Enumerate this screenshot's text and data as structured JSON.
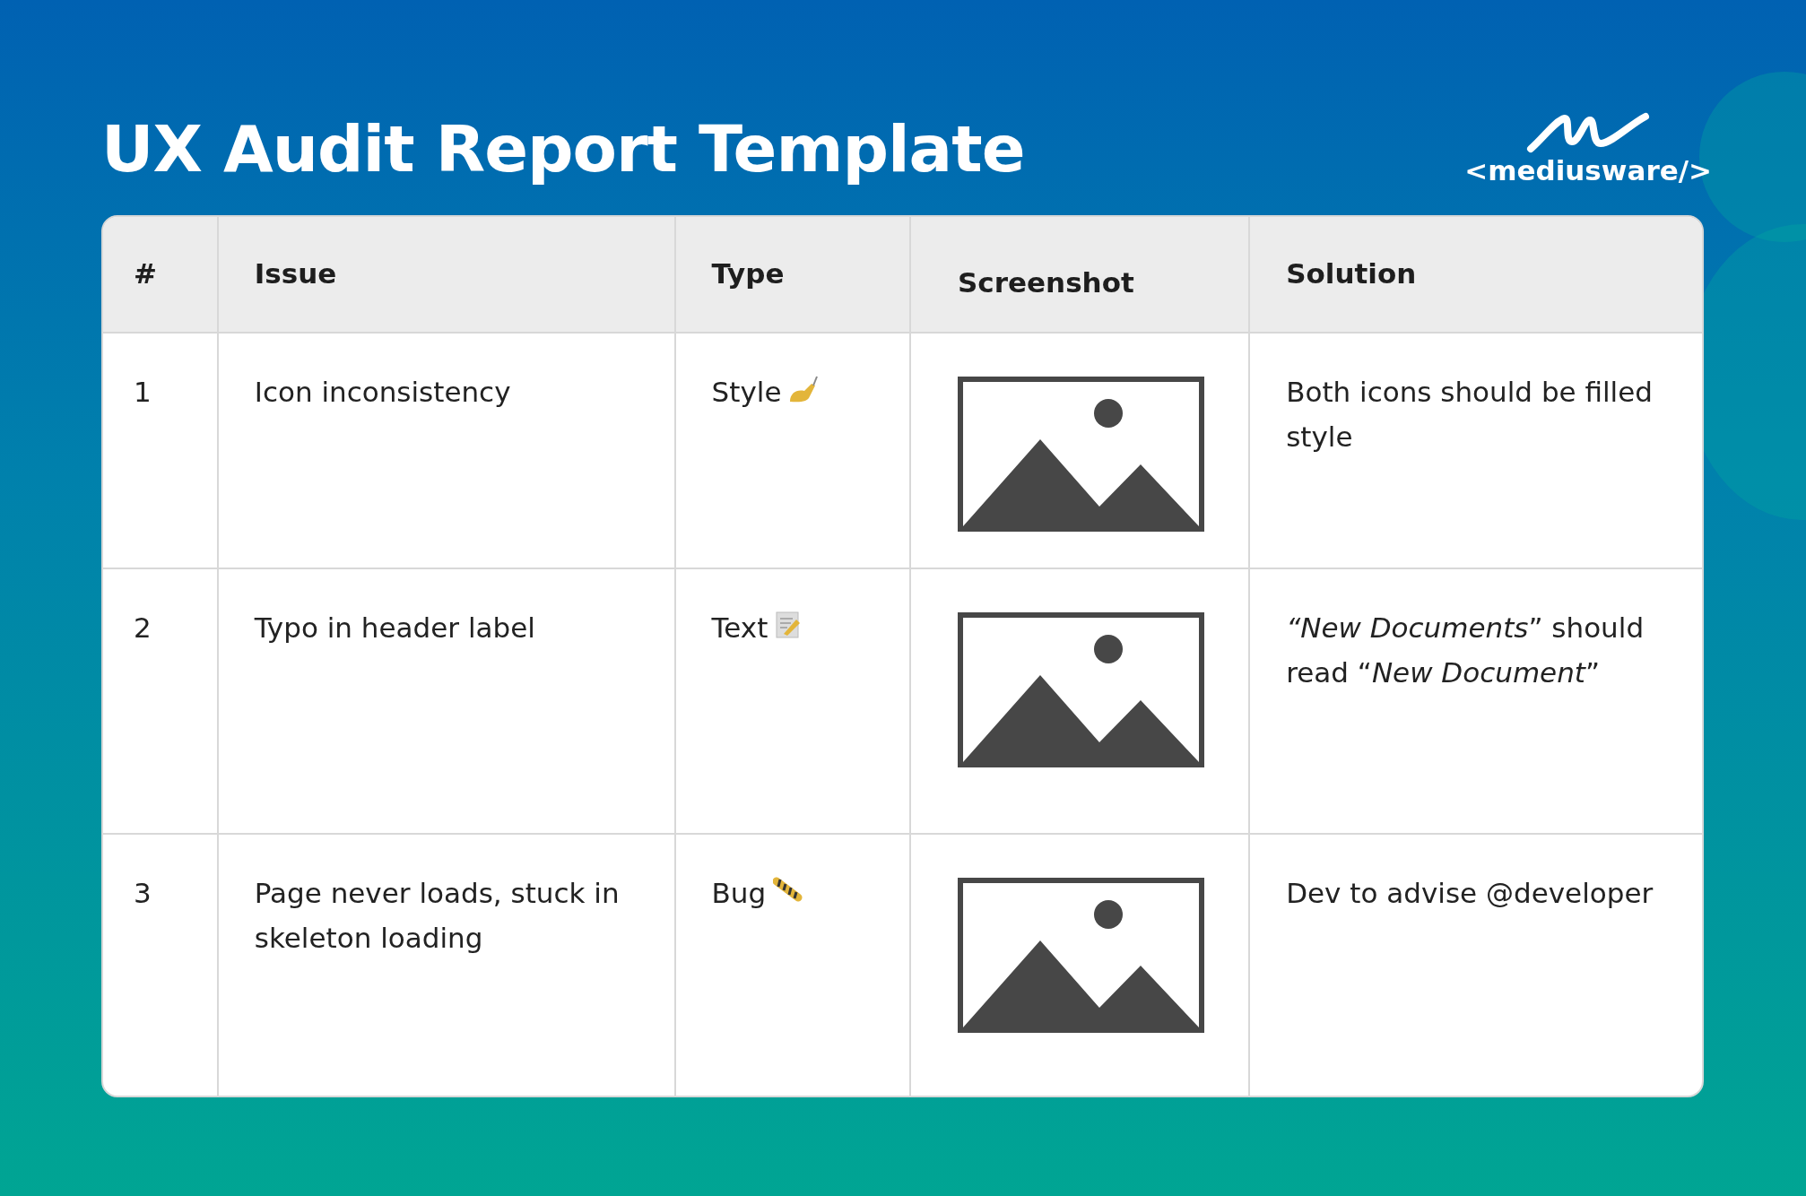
{
  "title": "UX Audit Report Template",
  "logo": {
    "text": "<mediusware/>"
  },
  "table": {
    "columns": [
      "#",
      "Issue",
      "Type",
      "Screenshot",
      "Solution"
    ],
    "rows": [
      {
        "number": "1",
        "issue": "Icon inconsistency",
        "type": {
          "label": "Style",
          "kind": "style"
        },
        "solution": "Both icons should be filled style"
      },
      {
        "number": "2",
        "issue": "Typo in header label",
        "type": {
          "label": "Text",
          "kind": "text"
        },
        "solution": "*“New Documents*” should read “*New Document*”"
      },
      {
        "number": "3",
        "issue": "Page never loads, stuck in skeleton loading",
        "type": {
          "label": "Bug",
          "kind": "bug"
        },
        "solution": "Dev to advise @developer"
      }
    ]
  }
}
